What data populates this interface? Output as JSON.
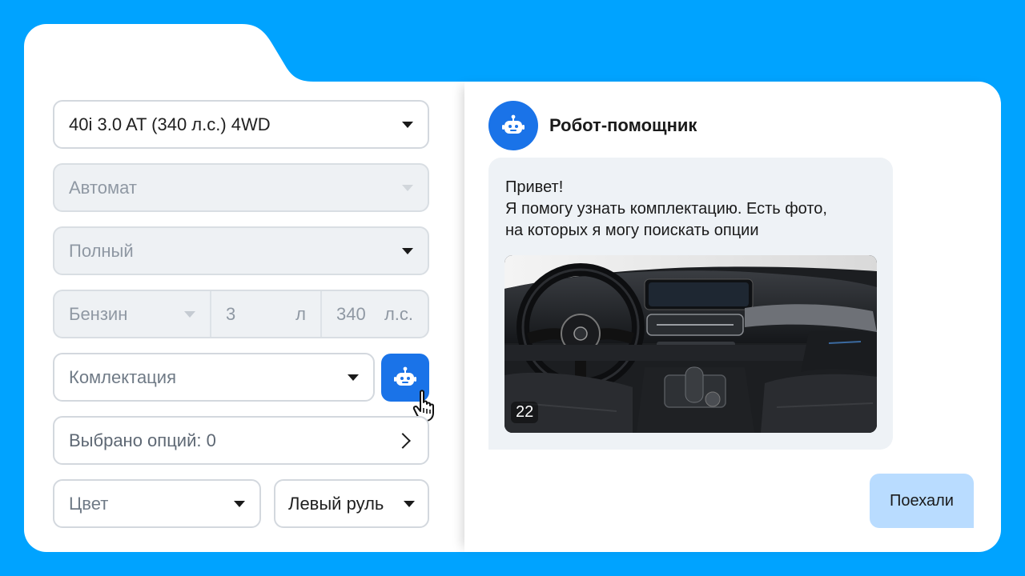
{
  "form": {
    "modification": "40i 3.0 AT (340 л.с.) 4WD",
    "transmission": "Автомат",
    "drive": "Полный",
    "engine": {
      "fuel": "Бензин",
      "volume": "3",
      "volume_unit": "л",
      "power": "340",
      "power_unit": "л.с."
    },
    "equipment_placeholder": "Комлектация",
    "options_selected": "Выбрано опций: 0",
    "color_placeholder": "Цвет",
    "steering": "Левый руль"
  },
  "chat": {
    "title": "Робот-помощник",
    "message_lines": [
      "Привет!",
      "Я помогу узнать комплектацию. Есть фото,",
      "на которых я могу поискать опции"
    ],
    "photo_count": "22",
    "reply_button": "Поехали"
  },
  "colors": {
    "background": "#00A3FF",
    "accent": "#1A73E8",
    "reply_bubble": "#B9DCFF"
  },
  "icons": [
    "robot-icon",
    "hand-pointer-icon",
    "chevron-right-icon",
    "caret-down-icon"
  ]
}
